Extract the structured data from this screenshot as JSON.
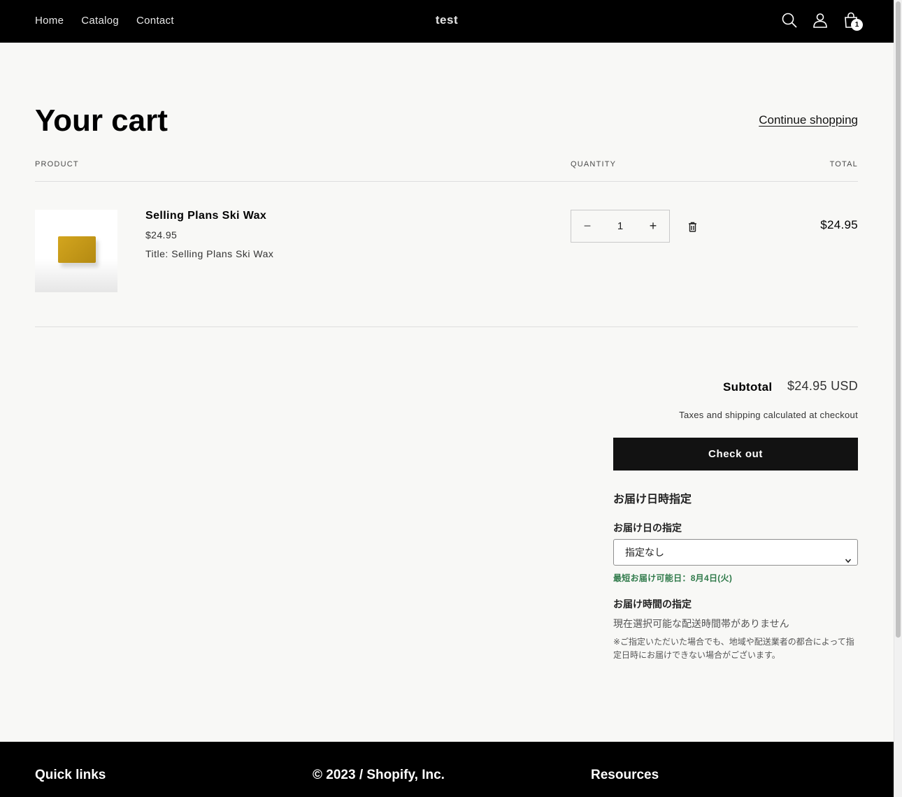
{
  "header": {
    "nav": [
      "Home",
      "Catalog",
      "Contact"
    ],
    "logo": "test",
    "icons": [
      "search-icon",
      "account-icon",
      "cart-icon"
    ],
    "cart_count": "1"
  },
  "cart": {
    "title": "Your cart",
    "continue_label": "Continue shopping",
    "columns": {
      "product": "PRODUCT",
      "quantity": "QUANTITY",
      "total": "TOTAL"
    },
    "item": {
      "name": "Selling Plans Ski Wax",
      "price": "$24.95",
      "option": "Title: Selling Plans Ski Wax",
      "quantity": "1",
      "minus": "−",
      "plus": "+",
      "total": "$24.95"
    },
    "subtotal_label": "Subtotal",
    "subtotal_value": "$24.95 USD",
    "tax_note": "Taxes and shipping calculated at checkout",
    "checkout_label": "Check out"
  },
  "delivery": {
    "heading": "お届け日時指定",
    "date_label": "お届け日の指定",
    "date_selected": "指定なし",
    "earliest": "最短お届け可能日：8月4日(火)",
    "time_label": "お届け時間の指定",
    "no_slot": "現在選択可能な配送時間帯がありません",
    "note": "※ご指定いただいた場合でも、地域や配送業者の都合によって指定日時にお届けできない場合がございます。"
  },
  "footer": {
    "quick_links": "Quick links",
    "copyright": "© 2023 / Shopify, Inc.",
    "resources": "Resources"
  },
  "colors": {
    "header_bg": "#000000",
    "page_bg": "#f8f8f6",
    "button_bg": "#121212",
    "accent_green": "#2f7a4a"
  }
}
